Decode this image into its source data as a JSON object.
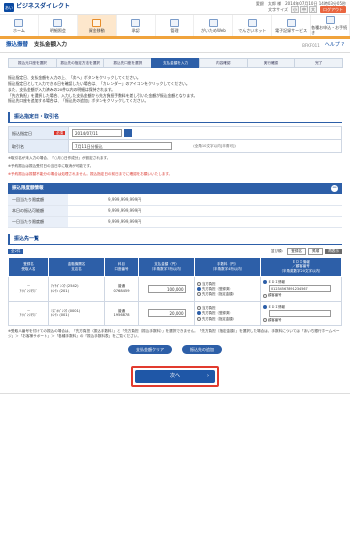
{
  "header": {
    "logo_mark": "あいぎん",
    "logo_text": "ビジネスダイレクト",
    "user_line": "愛銀　太郎 様　2014年07月10日 14時03分05秒",
    "font_size_label": "文字サイズ",
    "font_sizes": [
      "小",
      "中",
      "大"
    ],
    "logout": "ログアウト"
  },
  "nav": [
    {
      "label": "ホーム"
    },
    {
      "label": "明細照会"
    },
    {
      "label": "資金移動"
    },
    {
      "label": "承認"
    },
    {
      "label": "管理"
    },
    {
      "label": "がいためWeb"
    },
    {
      "label": "でんさいネット"
    },
    {
      "label": "電子記録サービス"
    },
    {
      "label": "各種お申込・お手続き"
    }
  ],
  "page": {
    "category": "振込振替",
    "title": "支払金額入力",
    "code": "BFKF011",
    "help": "ヘルプ ?"
  },
  "steps": [
    "振込元口座を選択",
    "振込先の指定方法を選択",
    "振込先口座を選択",
    "支払金額を入力",
    "内容確認",
    "実行確認",
    "完了"
  ],
  "intro": [
    "振込指定日、支払金額を入力の上、「次へ」ボタンをクリックしてください。",
    "振込指定日として入力できる日を確認したい場合は、「カレンダー」のアイコンをクリックしてください。",
    "また、支払金額が入力済みの20件以内の明細は保持されます。",
    "「先方負担」を選択した場合、入力した支払金額から先方負担手数料を差し引いた金額が振込金額となります。",
    "振込先口座を追加する場合は、「振込先の追加」ボタンをクリックしてください。"
  ],
  "date_section": {
    "heading": "振込指定日・取引名",
    "date_label": "振込指定日",
    "required": "必須",
    "date_value": "2014/07/11",
    "name_label": "取引名",
    "name_value": "7月11日分振込",
    "name_hint": "(全角10文字以内[半角可])"
  },
  "notes1": "※取引名が未入力の場合、「○月○日作成分」が設定されます。",
  "notes1b": "※予約振込は振込受付日の当日中に取消が可能です。",
  "notes_red": "※予約振込は振替不能分の場合は処理されません。振込指定日の前日までに確認をお願いいたします。",
  "limit_section": {
    "heading": "振込限度額情報",
    "rows": [
      {
        "label": "一回当たり限度額",
        "value": "9,999,999,999円"
      },
      {
        "label": "本日の振込可能額",
        "value": "9,999,999,999円"
      },
      {
        "label": "一日当たり限度額",
        "value": "9,999,999,999円"
      }
    ]
  },
  "payee_section": {
    "heading": "振込先一覧",
    "pager": "全2件",
    "sort_label": "並び順：",
    "sort_value": "登録名",
    "order_value": "昇順",
    "sort_button": "再表示",
    "columns": [
      "登録名\n受取人名",
      "金融機関名\n支店名",
      "科目\n口座番号",
      "支払金額（円）\n（半角数字7桁以内）",
      "手数料（円）\n（半角数字4桁以内）",
      "ＥＤＩ情報\n／顧客番号\n（半角英数字20文字以内）"
    ],
    "rows": [
      {
        "reg": "－",
        "payee": "ｱｲｷﾞﾝｼﾖｳｼﾞ",
        "bank": "ｱｲﾁｷﾞﾝｺｳ (2542)",
        "branch": "ﾎﾝﾃﾝ (201)",
        "type": "普通",
        "acct": "0768459",
        "amount": "100,000",
        "fee1": "当方負担",
        "fee2": "先方負担（登録済）",
        "fee3": "先方負担（指定金額）",
        "edi1": "ＥＤＩ情報",
        "edi_val": "0123456789123456​7",
        "edi2": "顧客番号"
      },
      {
        "reg": "－",
        "payee": "ｱｲｷﾞﾝｼﾖｳｼﾞ",
        "bank": "ﾐｽﾞﾎｷﾞﾝｺｳ (0001)",
        "branch": "ﾎﾝﾃﾝ (001)",
        "type": "普通",
        "acct": "1956878",
        "amount": "20,000",
        "fee1": "当方負担",
        "fee2": "先方負担（登録済）",
        "fee3": "先方負担（指定金額）",
        "edi1": "ＥＤＩ情報",
        "edi_val": "",
        "edi2": "顧客番号"
      }
    ]
  },
  "notes2": "※受取人番号を付けての振込の場合は、「先方負担（振込手数料）」と「先方負担（振込手数料）」を選択できません。「先方負担（指定金額）」を選択した場合は、手数料については「あいち銀行ホームページ」＞「お客様サポート」＞「各種手数料」の「振込手数料表」をご覧ください。",
  "buttons": {
    "clear": "支払金額クリア",
    "add": "振込先の追加",
    "next": "次へ"
  }
}
